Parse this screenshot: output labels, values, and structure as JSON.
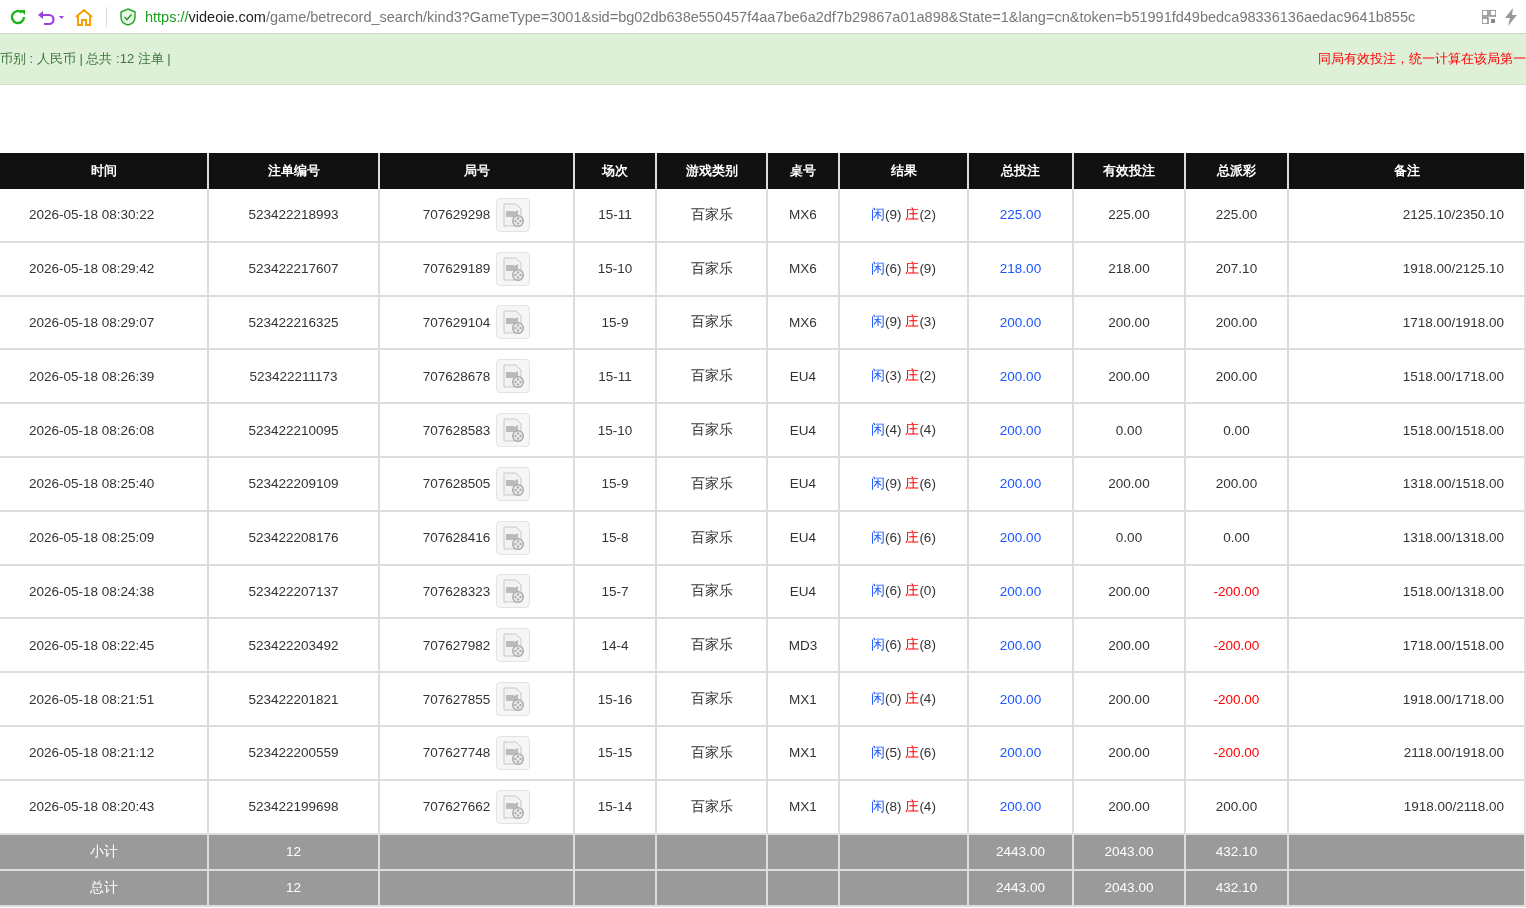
{
  "browser": {
    "url": {
      "scheme": "https://",
      "host": "videoie.com",
      "path": "/game/betrecord_search/kind3?GameType=3001&sid=bg02db638e550457f4aa7be6a2df7b29867a01a898&State=1&lang=cn&token=b51991fd49bedca98336136aedac9641b855c"
    }
  },
  "info_bar": {
    "summary": "币别 : 人民币 | 总共 :12 注单 |",
    "notice": "同局有效投注，统一计算在该局第一"
  },
  "table": {
    "columns": [
      "时间",
      "注单编号",
      "局号",
      "场次",
      "游戏类别",
      "桌号",
      "结果",
      "总投注",
      "有效投注",
      "总派彩",
      "备注"
    ],
    "rows": [
      {
        "time": "2026-05-18 08:30:22",
        "bet_no": "523422218993",
        "round_no": "707629298",
        "shoe": "15-11",
        "game": "百家乐",
        "table": "MX6",
        "result": [
          {
            "kind": "player",
            "side": "闲",
            "score": "(9)"
          },
          {
            "kind": "banker",
            "side": "庄",
            "score": "(2)"
          }
        ],
        "total_bet": "225.00",
        "valid_bet": "225.00",
        "payout": "225.00",
        "loss": false,
        "note": "2125.10/2350.10"
      },
      {
        "time": "2026-05-18 08:29:42",
        "bet_no": "523422217607",
        "round_no": "707629189",
        "shoe": "15-10",
        "game": "百家乐",
        "table": "MX6",
        "result": [
          {
            "kind": "player",
            "side": "闲",
            "score": "(6)"
          },
          {
            "kind": "banker",
            "side": "庄",
            "score": "(9)"
          }
        ],
        "total_bet": "218.00",
        "valid_bet": "218.00",
        "payout": "207.10",
        "loss": false,
        "note": "1918.00/2125.10"
      },
      {
        "time": "2026-05-18 08:29:07",
        "bet_no": "523422216325",
        "round_no": "707629104",
        "shoe": "15-9",
        "game": "百家乐",
        "table": "MX6",
        "result": [
          {
            "kind": "player",
            "side": "闲",
            "score": "(9)"
          },
          {
            "kind": "banker",
            "side": "庄",
            "score": "(3)"
          }
        ],
        "total_bet": "200.00",
        "valid_bet": "200.00",
        "payout": "200.00",
        "loss": false,
        "note": "1718.00/1918.00"
      },
      {
        "time": "2026-05-18 08:26:39",
        "bet_no": "523422211173",
        "round_no": "707628678",
        "shoe": "15-11",
        "game": "百家乐",
        "table": "EU4",
        "result": [
          {
            "kind": "player",
            "side": "闲",
            "score": "(3)"
          },
          {
            "kind": "banker",
            "side": "庄",
            "score": "(2)"
          }
        ],
        "total_bet": "200.00",
        "valid_bet": "200.00",
        "payout": "200.00",
        "loss": false,
        "note": "1518.00/1718.00"
      },
      {
        "time": "2026-05-18 08:26:08",
        "bet_no": "523422210095",
        "round_no": "707628583",
        "shoe": "15-10",
        "game": "百家乐",
        "table": "EU4",
        "result": [
          {
            "kind": "player",
            "side": "闲",
            "score": "(4)"
          },
          {
            "kind": "banker",
            "side": "庄",
            "score": "(4)"
          }
        ],
        "total_bet": "200.00",
        "valid_bet": "0.00",
        "payout": "0.00",
        "loss": false,
        "note": "1518.00/1518.00"
      },
      {
        "time": "2026-05-18 08:25:40",
        "bet_no": "523422209109",
        "round_no": "707628505",
        "shoe": "15-9",
        "game": "百家乐",
        "table": "EU4",
        "result": [
          {
            "kind": "player",
            "side": "闲",
            "score": "(9)"
          },
          {
            "kind": "banker",
            "side": "庄",
            "score": "(6)"
          }
        ],
        "total_bet": "200.00",
        "valid_bet": "200.00",
        "payout": "200.00",
        "loss": false,
        "note": "1318.00/1518.00"
      },
      {
        "time": "2026-05-18 08:25:09",
        "bet_no": "523422208176",
        "round_no": "707628416",
        "shoe": "15-8",
        "game": "百家乐",
        "table": "EU4",
        "result": [
          {
            "kind": "player",
            "side": "闲",
            "score": "(6)"
          },
          {
            "kind": "banker",
            "side": "庄",
            "score": "(6)"
          }
        ],
        "total_bet": "200.00",
        "valid_bet": "0.00",
        "payout": "0.00",
        "loss": false,
        "note": "1318.00/1318.00"
      },
      {
        "time": "2026-05-18 08:24:38",
        "bet_no": "523422207137",
        "round_no": "707628323",
        "shoe": "15-7",
        "game": "百家乐",
        "table": "EU4",
        "result": [
          {
            "kind": "player",
            "side": "闲",
            "score": "(6)"
          },
          {
            "kind": "banker",
            "side": "庄",
            "score": "(0)"
          }
        ],
        "total_bet": "200.00",
        "valid_bet": "200.00",
        "payout": "-200.00",
        "loss": true,
        "note": "1518.00/1318.00"
      },
      {
        "time": "2026-05-18 08:22:45",
        "bet_no": "523422203492",
        "round_no": "707627982",
        "shoe": "14-4",
        "game": "百家乐",
        "table": "MD3",
        "result": [
          {
            "kind": "player",
            "side": "闲",
            "score": "(6)"
          },
          {
            "kind": "banker",
            "side": "庄",
            "score": "(8)"
          }
        ],
        "total_bet": "200.00",
        "valid_bet": "200.00",
        "payout": "-200.00",
        "loss": true,
        "note": "1718.00/1518.00"
      },
      {
        "time": "2026-05-18 08:21:51",
        "bet_no": "523422201821",
        "round_no": "707627855",
        "shoe": "15-16",
        "game": "百家乐",
        "table": "MX1",
        "result": [
          {
            "kind": "player",
            "side": "闲",
            "score": "(0)"
          },
          {
            "kind": "banker",
            "side": "庄",
            "score": "(4)"
          }
        ],
        "total_bet": "200.00",
        "valid_bet": "200.00",
        "payout": "-200.00",
        "loss": true,
        "note": "1918.00/1718.00"
      },
      {
        "time": "2026-05-18 08:21:12",
        "bet_no": "523422200559",
        "round_no": "707627748",
        "shoe": "15-15",
        "game": "百家乐",
        "table": "MX1",
        "result": [
          {
            "kind": "player",
            "side": "闲",
            "score": "(5)"
          },
          {
            "kind": "banker",
            "side": "庄",
            "score": "(6)"
          }
        ],
        "total_bet": "200.00",
        "valid_bet": "200.00",
        "payout": "-200.00",
        "loss": true,
        "note": "2118.00/1918.00"
      },
      {
        "time": "2026-05-18 08:20:43",
        "bet_no": "523422199698",
        "round_no": "707627662",
        "shoe": "15-14",
        "game": "百家乐",
        "table": "MX1",
        "result": [
          {
            "kind": "player",
            "side": "闲",
            "score": "(8)"
          },
          {
            "kind": "banker",
            "side": "庄",
            "score": "(4)"
          }
        ],
        "total_bet": "200.00",
        "valid_bet": "200.00",
        "payout": "200.00",
        "loss": false,
        "note": "1918.00/2118.00"
      }
    ],
    "footer": [
      {
        "label": "小计",
        "count": "12",
        "total_bet": "2443.00",
        "valid_bet": "2043.00",
        "payout": "432.10"
      },
      {
        "label": "总计",
        "count": "12",
        "total_bet": "2443.00",
        "valid_bet": "2043.00",
        "payout": "432.10"
      }
    ]
  }
}
